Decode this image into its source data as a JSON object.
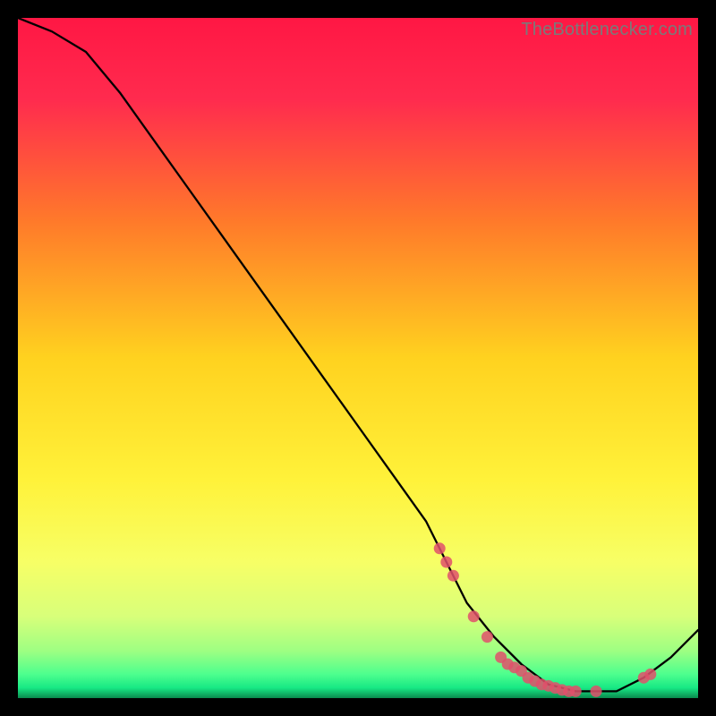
{
  "watermark": "TheBottlenecker.com",
  "chart_data": {
    "type": "line",
    "title": "",
    "xlabel": "",
    "ylabel": "",
    "xlim": [
      0,
      100
    ],
    "ylim": [
      0,
      100
    ],
    "series": [
      {
        "name": "bottleneck-curve",
        "x": [
          0,
          5,
          10,
          15,
          20,
          25,
          30,
          35,
          40,
          45,
          50,
          55,
          60,
          63,
          66,
          70,
          74,
          78,
          82,
          85,
          88,
          92,
          96,
          100
        ],
        "y": [
          100,
          98,
          95,
          89,
          82,
          75,
          68,
          61,
          54,
          47,
          40,
          33,
          26,
          20,
          14,
          9,
          5,
          2,
          1,
          1,
          1,
          3,
          6,
          10
        ]
      }
    ],
    "markers": {
      "name": "highlight-dots",
      "x": [
        62,
        63,
        64,
        67,
        69,
        71,
        72,
        73,
        74,
        75,
        76,
        77,
        78,
        79,
        80,
        81,
        82,
        85,
        92,
        93
      ],
      "y": [
        22,
        20,
        18,
        12,
        9,
        6,
        5,
        4.5,
        4,
        3,
        2.5,
        2,
        1.8,
        1.5,
        1.2,
        1,
        1,
        1,
        3,
        3.5
      ]
    },
    "gradient_bands": [
      {
        "stop": 0.0,
        "color": "#ff1744"
      },
      {
        "stop": 0.12,
        "color": "#ff2b4e"
      },
      {
        "stop": 0.3,
        "color": "#ff7a2a"
      },
      {
        "stop": 0.5,
        "color": "#ffd21f"
      },
      {
        "stop": 0.68,
        "color": "#fff23a"
      },
      {
        "stop": 0.8,
        "color": "#f7ff66"
      },
      {
        "stop": 0.88,
        "color": "#d8ff7a"
      },
      {
        "stop": 0.93,
        "color": "#9fff82"
      },
      {
        "stop": 0.965,
        "color": "#4dff8e"
      },
      {
        "stop": 0.985,
        "color": "#17e884"
      },
      {
        "stop": 1.0,
        "color": "#0a8a4e"
      }
    ]
  }
}
